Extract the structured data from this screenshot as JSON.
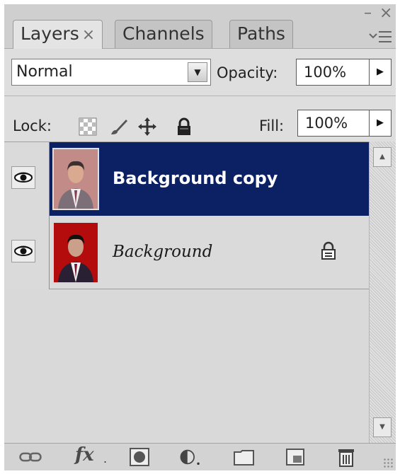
{
  "panel": {
    "tabs": [
      {
        "label": "Layers",
        "close": "×",
        "active": true
      },
      {
        "label": "Channels",
        "active": false
      },
      {
        "label": "Paths",
        "active": false
      }
    ],
    "controls": {
      "minimize": "–",
      "close": "×",
      "menu_icon": "panel-menu-icon"
    }
  },
  "blend": {
    "mode": "Normal",
    "opacity_label": "Opacity:",
    "opacity_value": "100%"
  },
  "lock": {
    "label": "Lock:",
    "icons": [
      "lock-transparent-pixels-icon",
      "lock-image-pixels-icon",
      "lock-position-icon",
      "lock-all-icon"
    ],
    "fill_label": "Fill:",
    "fill_value": "100%"
  },
  "layers": [
    {
      "name": "Background copy",
      "visible": true,
      "selected": true,
      "locked": false
    },
    {
      "name": "Background",
      "visible": true,
      "selected": false,
      "locked": true
    }
  ],
  "toolbar": {
    "icons": [
      "link-layers-icon",
      "fx-icon",
      "add-mask-icon",
      "adjustment-layer-icon",
      "new-group-icon",
      "new-layer-icon",
      "trash-icon"
    ],
    "fx_label": "fx"
  },
  "colors": {
    "selected_row": "#0c2064",
    "panel_bg": "#d6d6d6",
    "portrait_bg": "#b40c0c"
  }
}
